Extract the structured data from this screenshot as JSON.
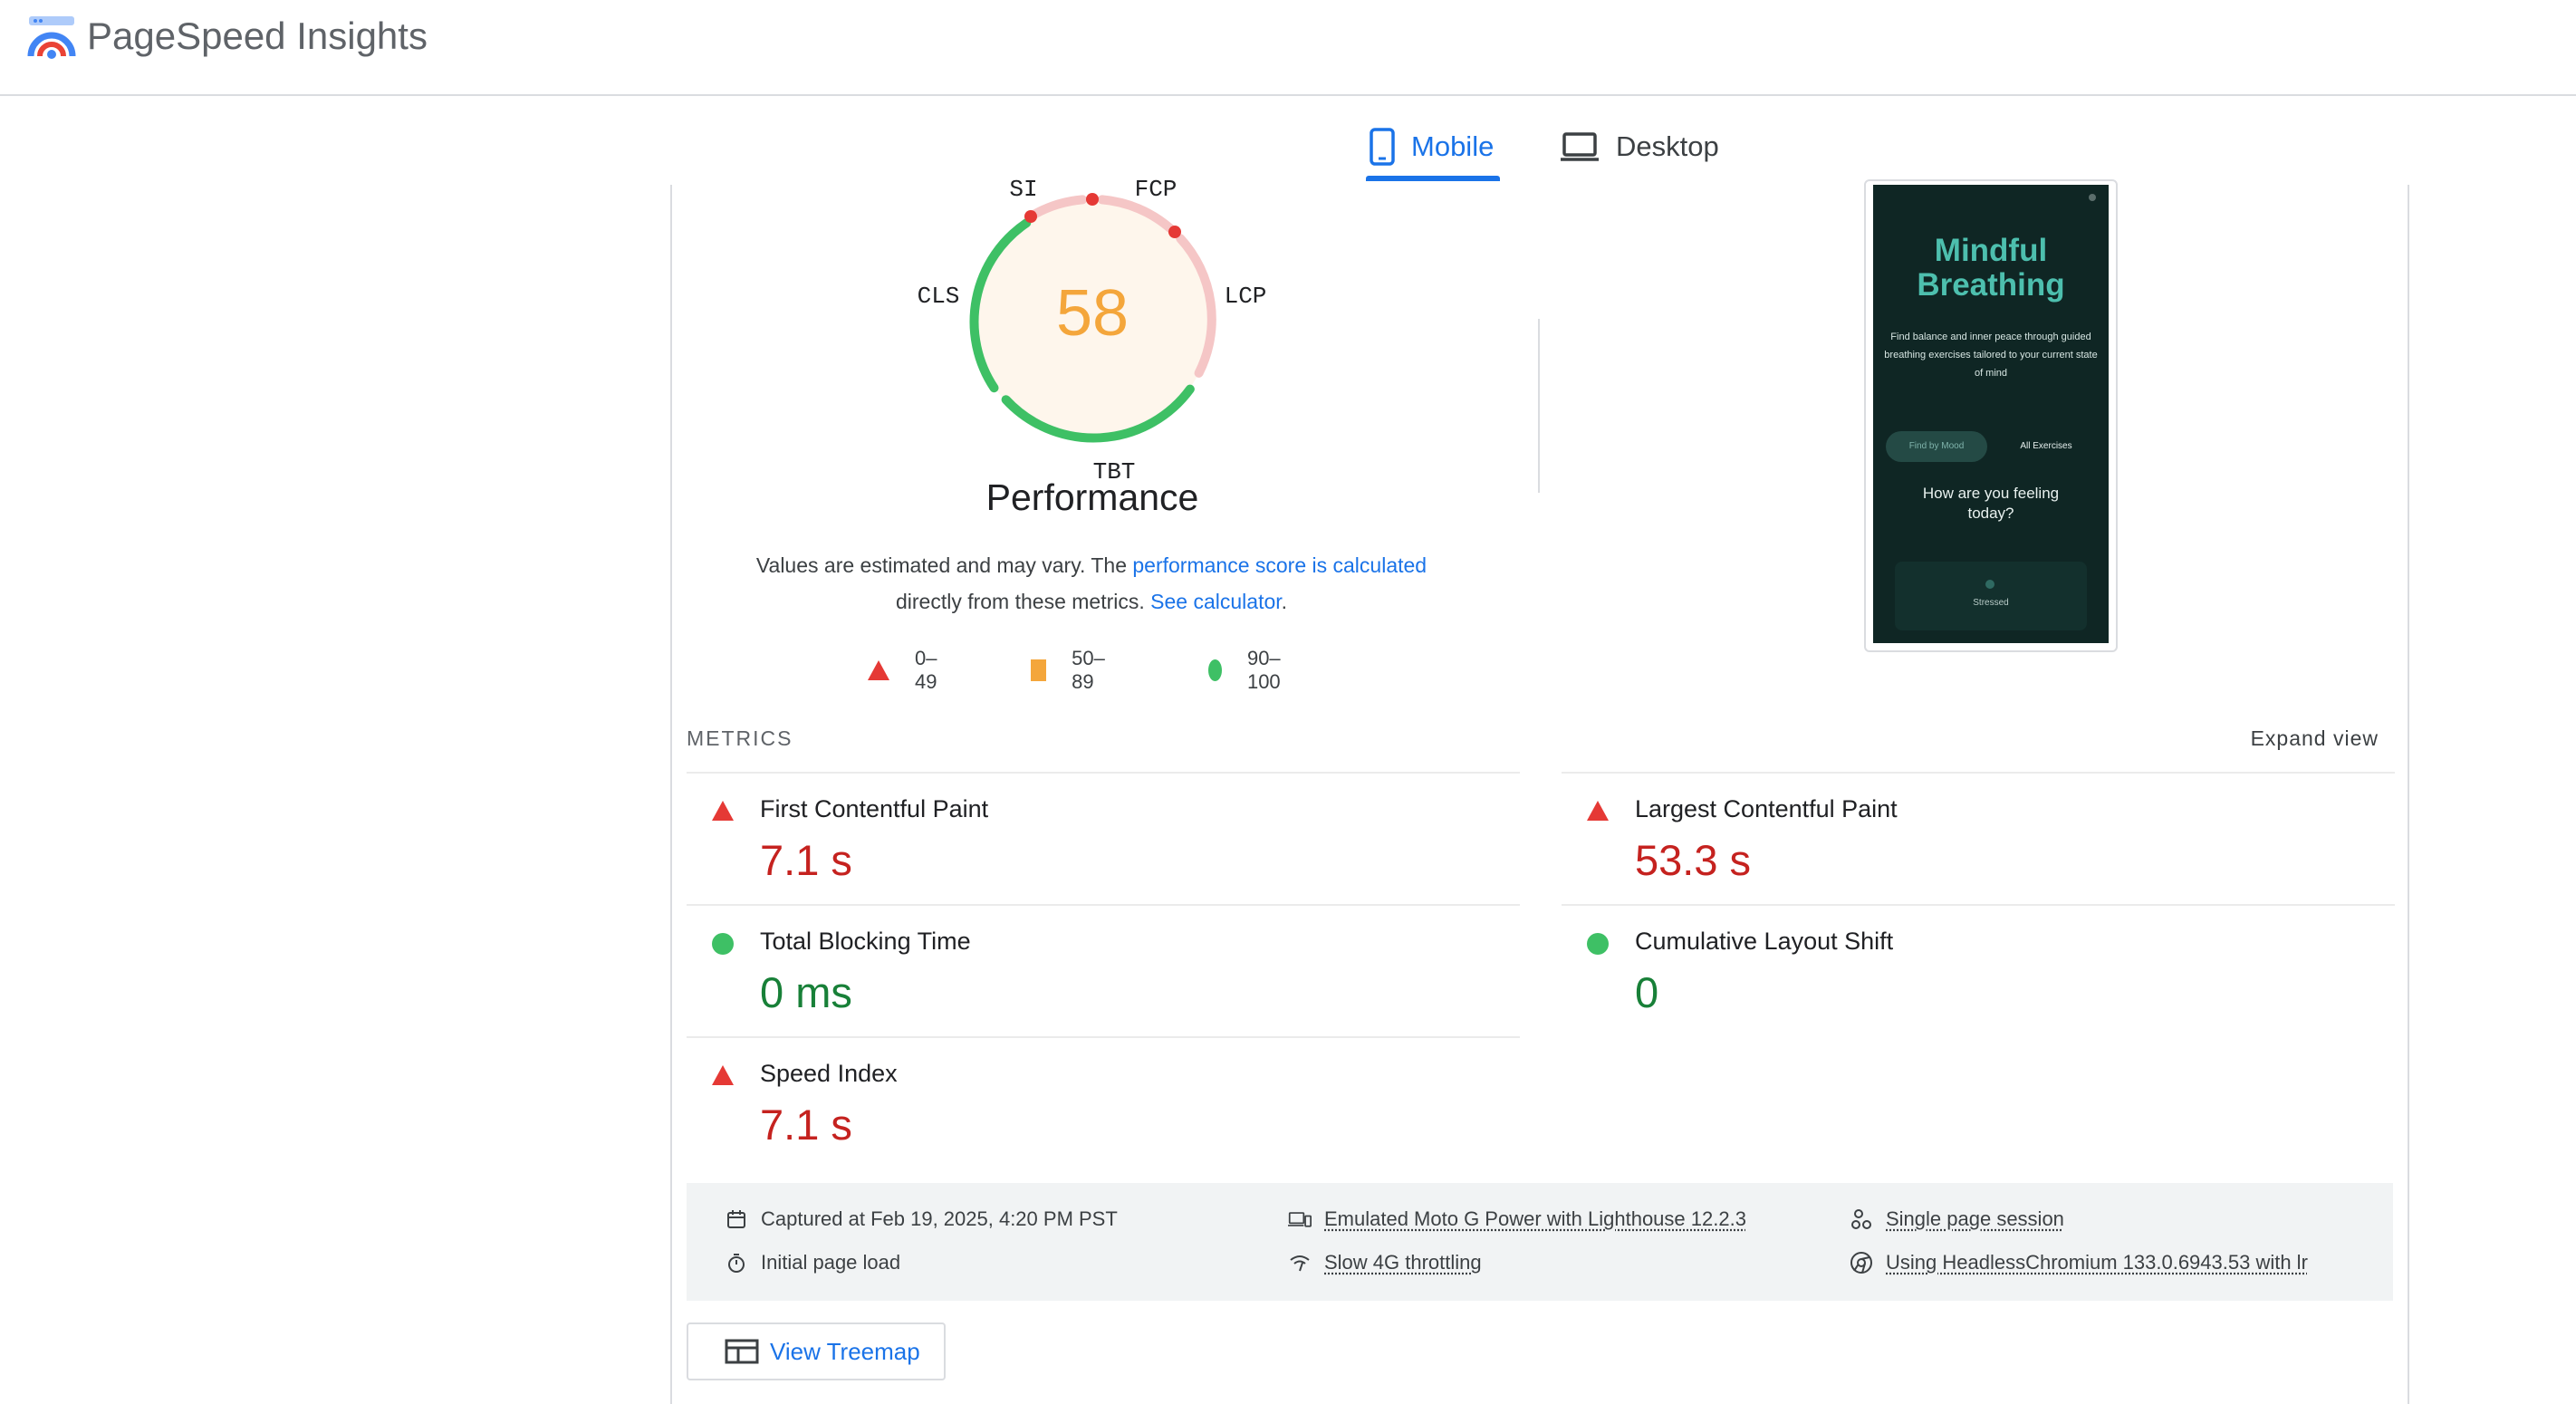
{
  "app": {
    "title": "PageSpeed Insights",
    "logo_icon": "pagespeed-logo-icon"
  },
  "tabs": [
    {
      "label": "Mobile",
      "icon": "phone-icon",
      "selected": true
    },
    {
      "label": "Desktop",
      "icon": "laptop-icon",
      "selected": false
    }
  ],
  "gauge": {
    "score": "58",
    "score_color": "#f4a63b",
    "labels": {
      "si": "SI",
      "fcp": "FCP",
      "lcp": "LCP",
      "tbt": "TBT",
      "cls": "CLS"
    },
    "title": "Performance"
  },
  "note": {
    "prefix": "Values are estimated and may vary. The ",
    "link1": "performance score is calculated",
    "middle": "directly from these metrics. ",
    "link2": "See calculator",
    "suffix": "."
  },
  "legend": [
    {
      "shape": "triangle",
      "label": "0–49",
      "color": "#e53935"
    },
    {
      "shape": "square",
      "label": "50–89",
      "color": "#f4a63b"
    },
    {
      "shape": "circle",
      "label": "90–100",
      "color": "#3ec065"
    }
  ],
  "screenshot": {
    "title": "Mindful Breathing",
    "title_line1": "Mindful",
    "title_line2": "Breathing",
    "subtitle": "Find balance and inner peace through guided breathing exercises tailored to your current state of mind",
    "pill_active": "Find by Mood",
    "pill_other": "All Exercises",
    "question": "How are you feeling today?",
    "card_label": "Stressed"
  },
  "metrics": {
    "heading": "METRICS",
    "expand": "Expand view",
    "fcp": {
      "name": "First Contentful Paint",
      "value": "7.1 s",
      "rating": "poor"
    },
    "lcp": {
      "name": "Largest Contentful Paint",
      "value": "53.3 s",
      "rating": "poor"
    },
    "tbt": {
      "name": "Total Blocking Time",
      "value": "0 ms",
      "rating": "good"
    },
    "cls": {
      "name": "Cumulative Layout Shift",
      "value": "0",
      "rating": "good"
    },
    "si": {
      "name": "Speed Index",
      "value": "7.1 s",
      "rating": "poor"
    }
  },
  "info": {
    "captured": "Captured at Feb 19, 2025, 4:20 PM PST",
    "initial_load": "Initial page load",
    "device": "Emulated Moto G Power with Lighthouse 12.2.3",
    "throttling": "Slow 4G throttling",
    "session": "Single page session",
    "browser": "Using HeadlessChromium 133.0.6943.53 with lr"
  },
  "treemap": {
    "label": "View Treemap"
  },
  "colors": {
    "accent": "#1a73e8",
    "poor": "#c5221f",
    "good": "#188038",
    "average": "#f4a63b"
  }
}
